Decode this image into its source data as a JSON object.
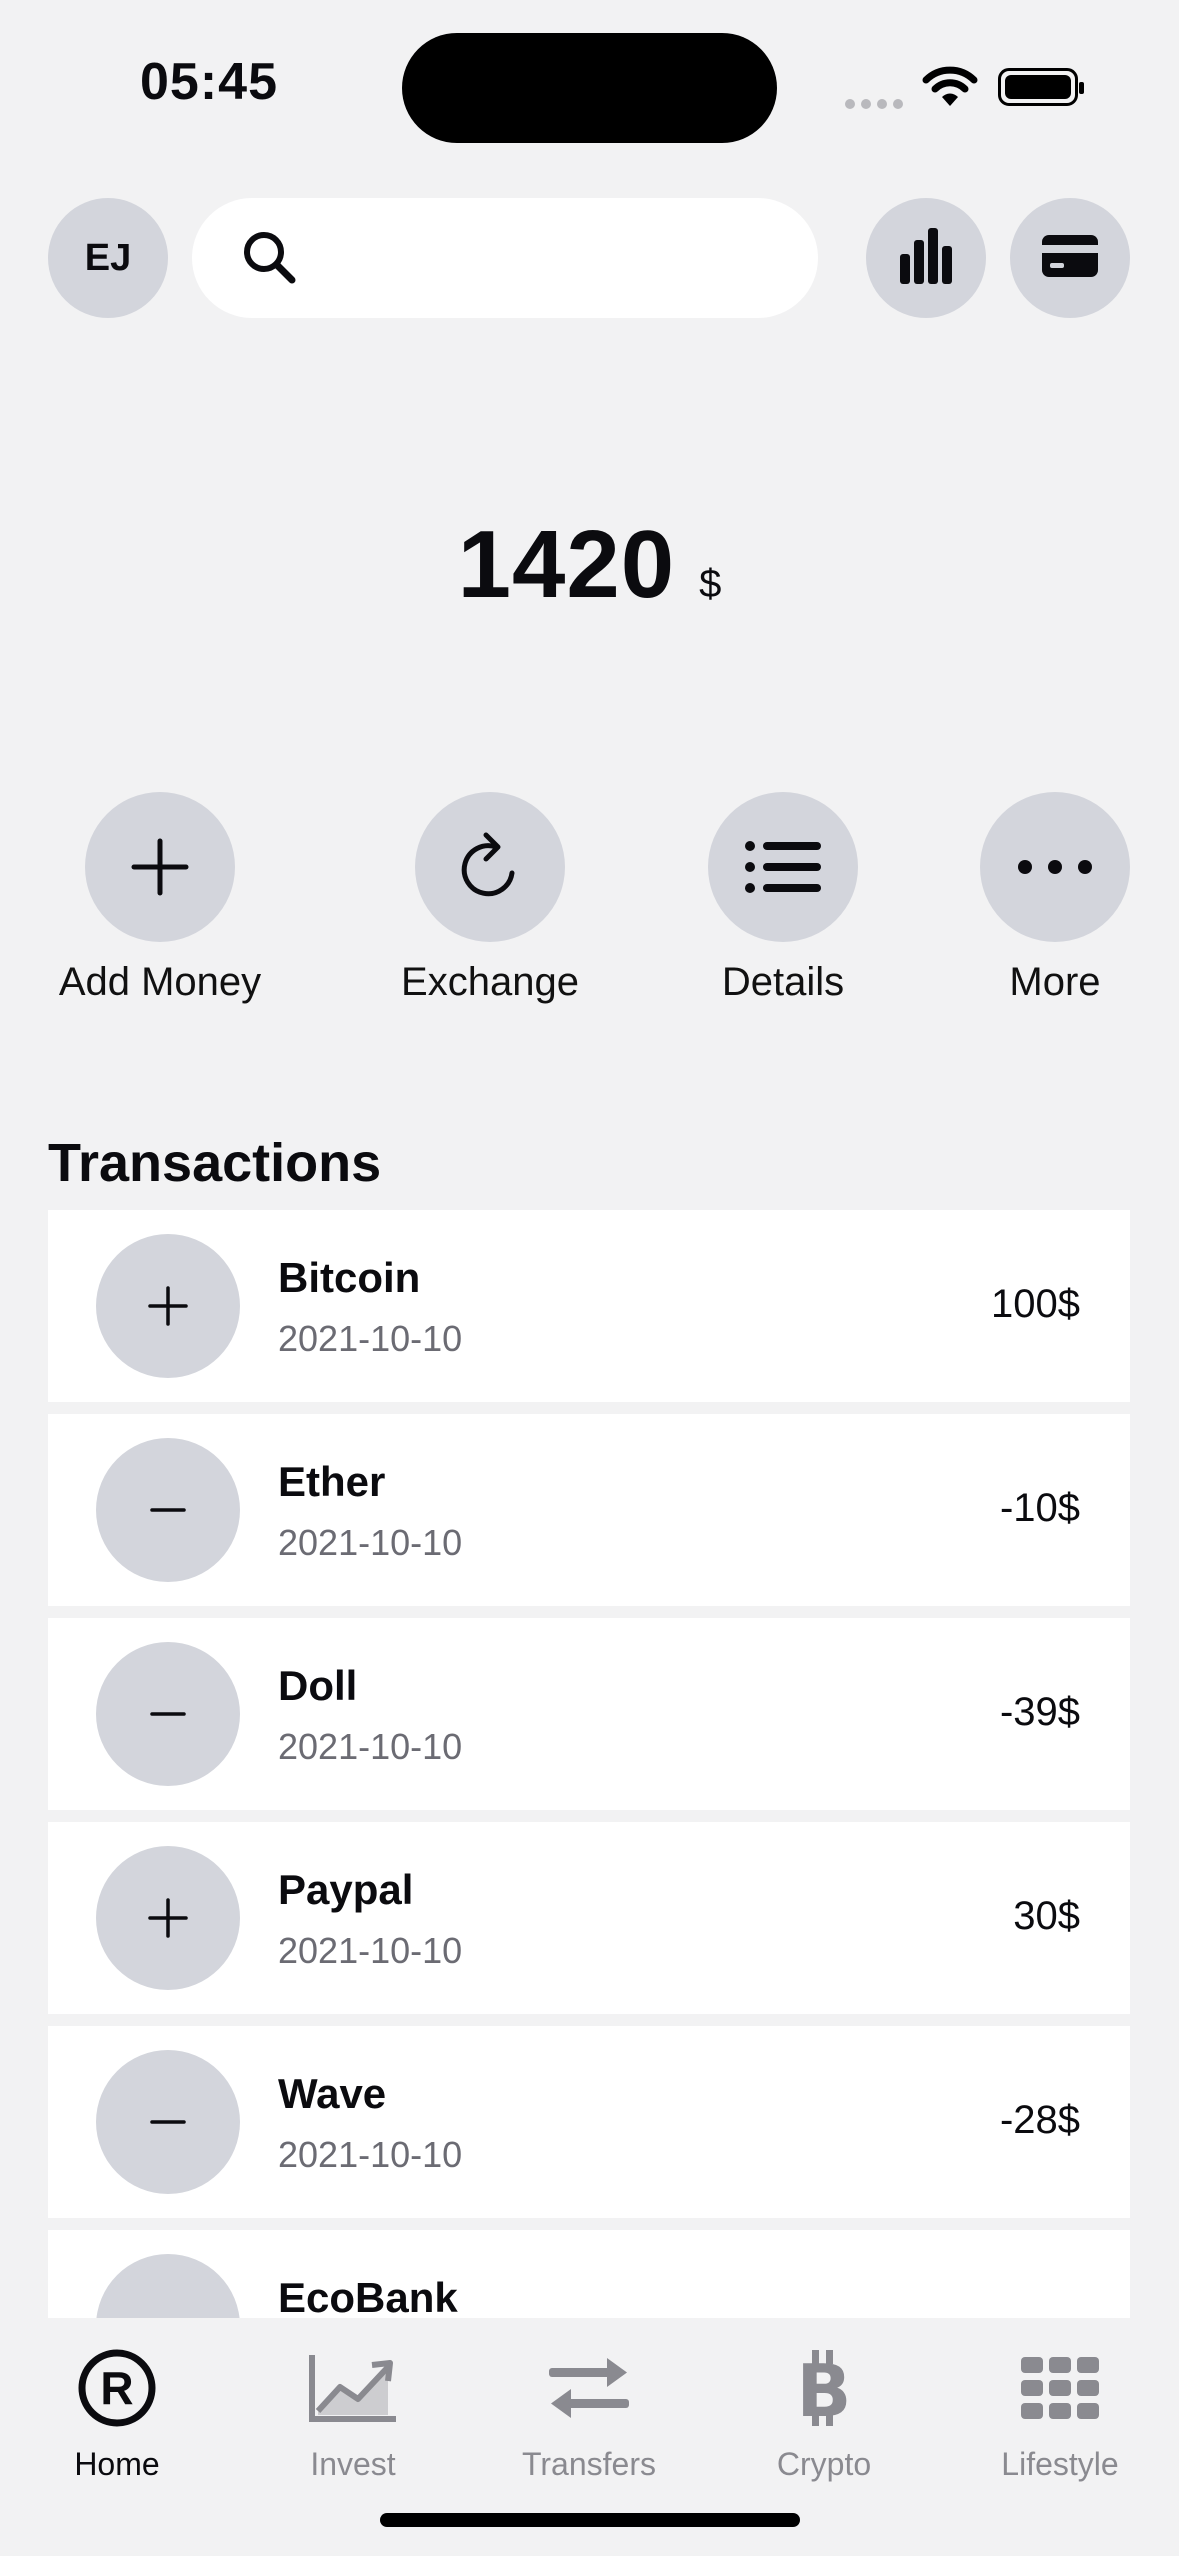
{
  "status_bar": {
    "time": "05:45"
  },
  "header": {
    "avatar_initials": "EJ",
    "search_placeholder": ""
  },
  "balance": {
    "amount": "1420",
    "currency": "$"
  },
  "actions": [
    {
      "label": "Add Money",
      "icon": "plus-icon"
    },
    {
      "label": "Exchange",
      "icon": "refresh-icon"
    },
    {
      "label": "Details",
      "icon": "list-icon"
    },
    {
      "label": "More",
      "icon": "more-dots-icon"
    }
  ],
  "transactions": {
    "title": "Transactions",
    "items": [
      {
        "name": "Bitcoin",
        "date": "2021-10-10",
        "amount": "100$",
        "type": "plus"
      },
      {
        "name": "Ether",
        "date": "2021-10-10",
        "amount": "-10$",
        "type": "minus"
      },
      {
        "name": "Doll",
        "date": "2021-10-10",
        "amount": "-39$",
        "type": "minus"
      },
      {
        "name": "Paypal",
        "date": "2021-10-10",
        "amount": "30$",
        "type": "plus"
      },
      {
        "name": "Wave",
        "date": "2021-10-10",
        "amount": "-28$",
        "type": "minus"
      },
      {
        "name": "EcoBank",
        "date": "",
        "amount": "",
        "type": "minus"
      }
    ]
  },
  "tabbar": [
    {
      "label": "Home",
      "icon": "registered-icon",
      "active": true
    },
    {
      "label": "Invest",
      "icon": "chart-line-icon",
      "active": false
    },
    {
      "label": "Transfers",
      "icon": "transfer-arrows-icon",
      "active": false
    },
    {
      "label": "Crypto",
      "icon": "bitcoin-icon",
      "active": false
    },
    {
      "label": "Lifestyle",
      "icon": "grid-icon",
      "active": false
    }
  ],
  "colors": {
    "background": "#f2f2f3",
    "circle": "#d3d5dc",
    "card": "#ffffff",
    "text": "#0b0b0f",
    "muted": "#6b6b73",
    "tab_inactive": "#8a8a90"
  }
}
